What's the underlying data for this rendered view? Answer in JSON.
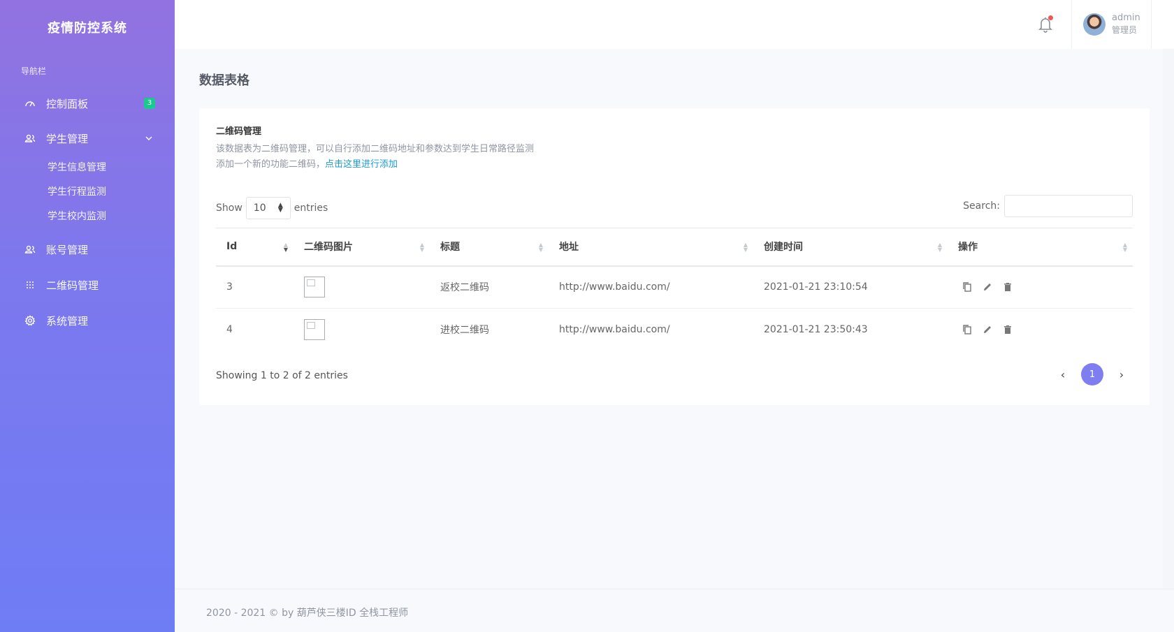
{
  "sidebar": {
    "brand": "疫情防控系统",
    "caption": "导航栏",
    "items": [
      {
        "label": "控制面板",
        "icon": "gauge-icon",
        "badge": "3"
      },
      {
        "label": "学生管理",
        "icon": "users-icon",
        "expanded": true
      },
      {
        "label": "账号管理",
        "icon": "user-group-icon"
      },
      {
        "label": "二维码管理",
        "icon": "grid-dots-icon"
      },
      {
        "label": "系统管理",
        "icon": "gear-icon"
      }
    ],
    "sub_items": [
      "学生信息管理",
      "学生行程监测",
      "学生校内监测"
    ]
  },
  "topbar": {
    "user_name": "admin",
    "user_role": "管理员"
  },
  "page": {
    "title": "数据表格",
    "card_title": "二维码管理",
    "card_desc": "该数据表为二维码管理，可以自行添加二维码地址和参数达到学生日常路径监测",
    "card_desc2": "添加一个新的功能二维码，",
    "card_link": "点击这里进行添加"
  },
  "table": {
    "show_label": "Show",
    "entries_label": "entries",
    "page_size": "10",
    "search_label": "Search:",
    "columns": [
      "Id",
      "二维码图片",
      "标题",
      "地址",
      "创建时间",
      "操作"
    ],
    "rows": [
      {
        "id": "3",
        "title": "返校二维码",
        "url": "http://www.baidu.com/",
        "created": "2021-01-21 23:10:54"
      },
      {
        "id": "4",
        "title": "进校二维码",
        "url": "http://www.baidu.com/",
        "created": "2021-01-21 23:50:43"
      }
    ],
    "showing": "Showing 1 to 2 of 2 entries",
    "pager": {
      "prev": "‹",
      "current": "1",
      "next": "›"
    }
  },
  "footer": {
    "text": "2020 - 2021 © by 葫芦侠三楼ID 全栈工程师"
  },
  "colors": {
    "sidebar_top": "#9272e0",
    "sidebar_bottom": "#6f7df5",
    "badge": "#1bc98e",
    "accent": "#7f7ef0",
    "link": "#1a9bd7"
  }
}
